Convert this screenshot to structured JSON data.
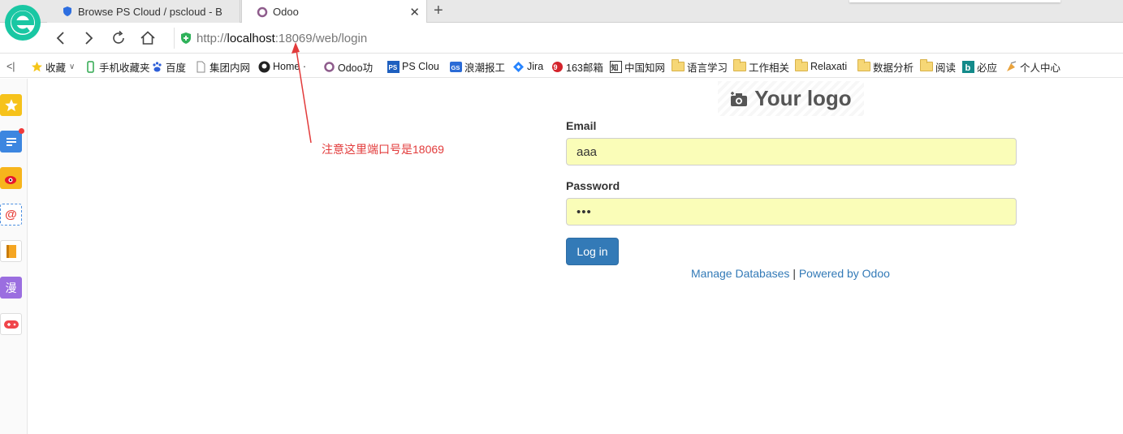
{
  "browser": {
    "tabs": [
      {
        "title": "Browse PS Cloud / pscloud - B",
        "active": false
      },
      {
        "title": "Odoo",
        "active": true
      }
    ],
    "url": {
      "scheme": "http://",
      "host": "localhost",
      "port_path": ":18069/web/login"
    }
  },
  "bookmarks": [
    {
      "label": "收藏",
      "icon": "star-icon"
    },
    {
      "label": "手机收藏夹",
      "icon": "phone-icon"
    },
    {
      "label": "百度",
      "icon": "baidu-icon"
    },
    {
      "label": "集团内网",
      "icon": "page-icon"
    },
    {
      "label": "Home ·",
      "icon": "github-icon"
    },
    {
      "label": "Odoo功",
      "icon": "odoo-icon"
    },
    {
      "label": "PS Clou",
      "icon": "ps-icon"
    },
    {
      "label": "浪潮报工",
      "icon": "gs-icon"
    },
    {
      "label": "Jira",
      "icon": "jira-icon"
    },
    {
      "label": "163邮箱",
      "icon": "163-icon"
    },
    {
      "label": "中国知网",
      "icon": "cnki-icon"
    },
    {
      "label": "语言学习",
      "icon": "folder-icon"
    },
    {
      "label": "工作相关",
      "icon": "folder-icon"
    },
    {
      "label": "Relaxati",
      "icon": "folder-icon"
    },
    {
      "label": "数据分析",
      "icon": "folder-icon"
    },
    {
      "label": "阅读",
      "icon": "folder-icon"
    },
    {
      "label": "必应",
      "icon": "bing-icon"
    },
    {
      "label": "个人中心",
      "icon": "user-center-icon"
    }
  ],
  "login": {
    "logo_text": "Your logo",
    "email_label": "Email",
    "email_value": "aaa",
    "password_label": "Password",
    "password_value": "•••",
    "login_button": "Log in",
    "manage_db": "Manage Databases",
    "separator": "|",
    "powered_by": "Powered by Odoo"
  },
  "annotation": {
    "text": "注意这里端口号是18069",
    "color": "#e23b3b"
  },
  "colors": {
    "primary_button": "#337ab7",
    "autofill_bg": "#fafdb8"
  }
}
